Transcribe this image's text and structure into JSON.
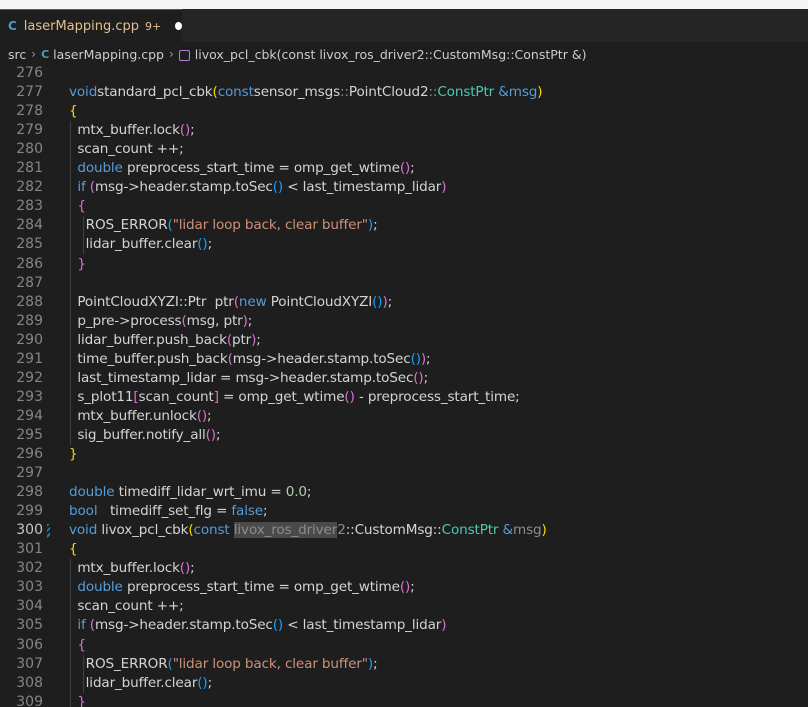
{
  "window": {
    "title_fragment": ""
  },
  "tab": {
    "title": "laserMapping.cpp",
    "badge": "9+",
    "icon": "C",
    "modified": true
  },
  "breadcrumb": {
    "folder": "src",
    "file": "laserMapping.cpp",
    "symbol": "livox_pcl_cbk(const livox_ros_driver2::CustomMsg::ConstPtr &)"
  },
  "colors": {
    "background": "#1e1e1e",
    "keyword": "#569cd6",
    "function": "#dcdcaa",
    "type": "#4ec9b0",
    "string": "#ce9178",
    "tab_modified": "#e2c08d"
  },
  "editor": {
    "active_line": 300,
    "lines": [
      {
        "n": 276,
        "tokens": []
      },
      {
        "n": 277,
        "tokens": [
          [
            "kw",
            "void"
          ],
          [
            "",
            "standard_pcl_cbk"
          ],
          [
            "b1",
            "("
          ],
          [
            "kw",
            "const"
          ],
          [
            "",
            "sensor_msgs"
          ],
          [
            "ns",
            "::"
          ],
          [
            "",
            "PointCloud2"
          ],
          [
            "ns",
            "::"
          ],
          [
            "ty",
            "ConstPtr"
          ],
          [
            "",
            " "
          ],
          [
            "kw",
            "&msg"
          ],
          [
            "b1",
            ")"
          ]
        ]
      },
      {
        "n": 278,
        "tokens": [
          [
            "b1",
            "{"
          ]
        ]
      },
      {
        "n": 279,
        "tokens": [
          [
            "",
            "  mtx_buffer.lock"
          ],
          [
            "b2",
            "()"
          ],
          [
            "",
            ";"
          ]
        ]
      },
      {
        "n": 280,
        "tokens": [
          [
            "",
            "  scan_count ++;"
          ]
        ]
      },
      {
        "n": 281,
        "tokens": [
          [
            "",
            "  "
          ],
          [
            "kw",
            "double"
          ],
          [
            "",
            " preprocess_start_time = omp_get_wtime"
          ],
          [
            "b2",
            "()"
          ],
          [
            "",
            ";"
          ]
        ]
      },
      {
        "n": 282,
        "tokens": [
          [
            "",
            "  "
          ],
          [
            "kw",
            "if"
          ],
          [
            "",
            " "
          ],
          [
            "b2",
            "("
          ],
          [
            "",
            "msg->header.stamp.toSec"
          ],
          [
            "b3",
            "()"
          ],
          [
            "",
            " < last_timestamp_lidar"
          ],
          [
            "b2",
            ")"
          ]
        ]
      },
      {
        "n": 283,
        "tokens": [
          [
            "",
            "  "
          ],
          [
            "b2",
            "{"
          ]
        ]
      },
      {
        "n": 284,
        "tokens": [
          [
            "",
            "    ROS_ERROR"
          ],
          [
            "b3",
            "("
          ],
          [
            "str",
            "\"lidar loop back, clear buffer\""
          ],
          [
            "b3",
            ")"
          ],
          [
            "",
            ";"
          ]
        ]
      },
      {
        "n": 285,
        "tokens": [
          [
            "",
            "    lidar_buffer.clear"
          ],
          [
            "b3",
            "()"
          ],
          [
            "",
            ";"
          ]
        ]
      },
      {
        "n": 286,
        "tokens": [
          [
            "",
            "  "
          ],
          [
            "b2",
            "}"
          ]
        ]
      },
      {
        "n": 287,
        "tokens": []
      },
      {
        "n": 288,
        "tokens": [
          [
            "",
            "  PointCloudXYZI::Ptr  ptr"
          ],
          [
            "b2",
            "("
          ],
          [
            "kw",
            "new"
          ],
          [
            "",
            " PointCloudXYZI"
          ],
          [
            "b3",
            "()"
          ],
          [
            "b2",
            ")"
          ],
          [
            "",
            ";"
          ]
        ]
      },
      {
        "n": 289,
        "tokens": [
          [
            "",
            "  p_pre->process"
          ],
          [
            "b2",
            "("
          ],
          [
            "",
            "msg, ptr"
          ],
          [
            "b2",
            ")"
          ],
          [
            "",
            ";"
          ]
        ]
      },
      {
        "n": 290,
        "tokens": [
          [
            "",
            "  lidar_buffer.push_back"
          ],
          [
            "b2",
            "("
          ],
          [
            "",
            "ptr"
          ],
          [
            "b2",
            ")"
          ],
          [
            "",
            ";"
          ]
        ]
      },
      {
        "n": 291,
        "tokens": [
          [
            "",
            "  time_buffer.push_back"
          ],
          [
            "b2",
            "("
          ],
          [
            "",
            "msg->header.stamp.toSec"
          ],
          [
            "b3",
            "()"
          ],
          [
            "b2",
            ")"
          ],
          [
            "",
            ";"
          ]
        ]
      },
      {
        "n": 292,
        "tokens": [
          [
            "",
            "  last_timestamp_lidar = msg->header.stamp.toSec"
          ],
          [
            "b2",
            "()"
          ],
          [
            "",
            ";"
          ]
        ]
      },
      {
        "n": 293,
        "tokens": [
          [
            "",
            "  s_plot11"
          ],
          [
            "b2",
            "["
          ],
          [
            "",
            "scan_count"
          ],
          [
            "b2",
            "]"
          ],
          [
            "",
            " = omp_get_wtime"
          ],
          [
            "b2",
            "()"
          ],
          [
            "",
            " - preprocess_start_time;"
          ]
        ]
      },
      {
        "n": 294,
        "tokens": [
          [
            "",
            "  mtx_buffer.unlock"
          ],
          [
            "b2",
            "()"
          ],
          [
            "",
            ";"
          ]
        ]
      },
      {
        "n": 295,
        "tokens": [
          [
            "",
            "  sig_buffer.notify_all"
          ],
          [
            "b2",
            "()"
          ],
          [
            "",
            ";"
          ]
        ]
      },
      {
        "n": 296,
        "tokens": [
          [
            "b1",
            "}"
          ]
        ]
      },
      {
        "n": 297,
        "tokens": []
      },
      {
        "n": 298,
        "tokens": [
          [
            "kw",
            "double"
          ],
          [
            "",
            " timediff_lidar_wrt_imu = "
          ],
          [
            "num",
            "0.0"
          ],
          [
            "",
            ";"
          ]
        ]
      },
      {
        "n": 299,
        "tokens": [
          [
            "kw",
            "bool"
          ],
          [
            "",
            "   timediff_set_flg = "
          ],
          [
            "kw",
            "false"
          ],
          [
            "",
            ";"
          ]
        ]
      },
      {
        "n": 300,
        "tokens": [
          [
            "kw",
            "void"
          ],
          [
            "",
            " livox_pcl_cbk"
          ],
          [
            "b1",
            "("
          ],
          [
            "kw",
            "const"
          ],
          [
            "",
            " "
          ],
          [
            "hl",
            "livox_ros_driver"
          ],
          [
            "ns",
            "2"
          ],
          [
            "",
            "::CustomMsg::"
          ],
          [
            "ty",
            "ConstPtr"
          ],
          [
            "",
            " "
          ],
          [
            "kw",
            "&"
          ],
          [
            "ns",
            "msg"
          ],
          [
            "b1",
            ")"
          ]
        ]
      },
      {
        "n": 301,
        "tokens": [
          [
            "b1",
            "{"
          ]
        ]
      },
      {
        "n": 302,
        "tokens": [
          [
            "",
            "  mtx_buffer.lock"
          ],
          [
            "b2",
            "()"
          ],
          [
            "",
            ";"
          ]
        ]
      },
      {
        "n": 303,
        "tokens": [
          [
            "",
            "  "
          ],
          [
            "kw",
            "double"
          ],
          [
            "",
            " preprocess_start_time = omp_get_wtime"
          ],
          [
            "b2",
            "()"
          ],
          [
            "",
            ";"
          ]
        ]
      },
      {
        "n": 304,
        "tokens": [
          [
            "",
            "  scan_count ++;"
          ]
        ]
      },
      {
        "n": 305,
        "tokens": [
          [
            "",
            "  "
          ],
          [
            "kw",
            "if"
          ],
          [
            "",
            " "
          ],
          [
            "b2",
            "("
          ],
          [
            "",
            "msg->header.stamp.toSec"
          ],
          [
            "b3",
            "()"
          ],
          [
            "",
            " < last_timestamp_lidar"
          ],
          [
            "b2",
            ")"
          ]
        ]
      },
      {
        "n": 306,
        "tokens": [
          [
            "",
            "  "
          ],
          [
            "b2",
            "{"
          ]
        ]
      },
      {
        "n": 307,
        "tokens": [
          [
            "",
            "    ROS_ERROR"
          ],
          [
            "b3",
            "("
          ],
          [
            "str",
            "\"lidar loop back, clear buffer\""
          ],
          [
            "b3",
            ")"
          ],
          [
            "",
            ";"
          ]
        ]
      },
      {
        "n": 308,
        "tokens": [
          [
            "",
            "    lidar_buffer.clear"
          ],
          [
            "b3",
            "()"
          ],
          [
            "",
            ";"
          ]
        ]
      },
      {
        "n": 309,
        "tokens": [
          [
            "",
            "  "
          ],
          [
            "b2",
            "}"
          ]
        ]
      }
    ]
  }
}
